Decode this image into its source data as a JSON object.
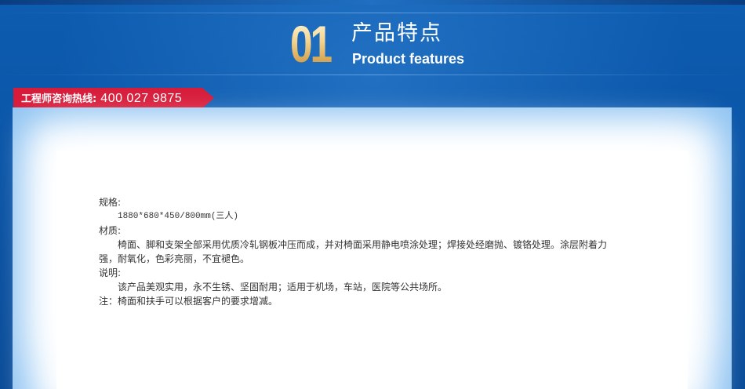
{
  "header": {
    "number": "01",
    "title_cn": "产品特点",
    "title_en": "Product features"
  },
  "hotline": {
    "label": "工程师咨询热线:",
    "phone": "400 027 9875"
  },
  "content": {
    "spec_label": "规格:",
    "spec_value": "1880*680*450/800mm(三人)",
    "material_label": "材质:",
    "material_text": "椅面、脚和支架全部采用优质冷轧钢板冲压而成，并对椅面采用静电喷涂处理；焊接处经磨抛、镀铬处理。涂层附着力强，耐氧化，色彩亮丽，不宜褪色。",
    "desc_label": "说明:",
    "desc_text": "该产品美观实用，永不生锈、坚固耐用；适用于机场，车站，医院等公共场所。",
    "note": "注：椅面和扶手可以根据客户的要求增减。"
  },
  "colors": {
    "background": "#0a55a8",
    "hotline_bg": "#d71c3a",
    "panel_glow": "#8cc2f2",
    "text": "#333333"
  }
}
